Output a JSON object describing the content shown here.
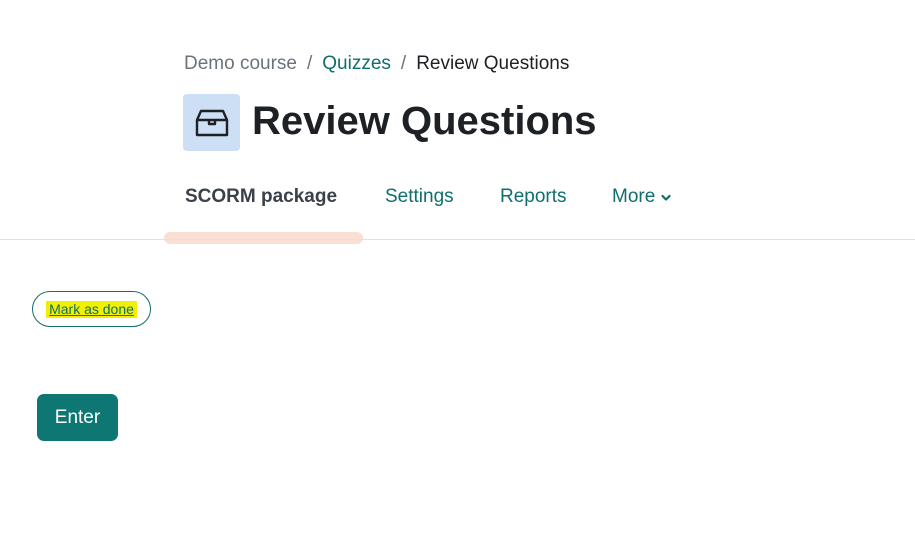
{
  "breadcrumb": {
    "items": [
      {
        "label": "Demo course",
        "style": "muted"
      },
      {
        "label": "Quizzes",
        "style": "link"
      },
      {
        "label": "Review Questions",
        "style": "current"
      }
    ],
    "separator": "/"
  },
  "header": {
    "icon": "package-box-icon",
    "title": "Review Questions"
  },
  "tabs": [
    {
      "label": "SCORM package",
      "active": true
    },
    {
      "label": "Settings",
      "active": false
    },
    {
      "label": "Reports",
      "active": false
    },
    {
      "label": "More",
      "active": false,
      "icon": "chevron-down-icon"
    }
  ],
  "completion": {
    "mark_done_label": "Mark as done"
  },
  "actions": {
    "enter_label": "Enter"
  },
  "colors": {
    "link": "#0f6e6e",
    "primary_button": "#0f7773",
    "icon_background": "#cddff5",
    "active_tab_highlight": "#fadfd5",
    "text_highlight": "#f0f000"
  }
}
